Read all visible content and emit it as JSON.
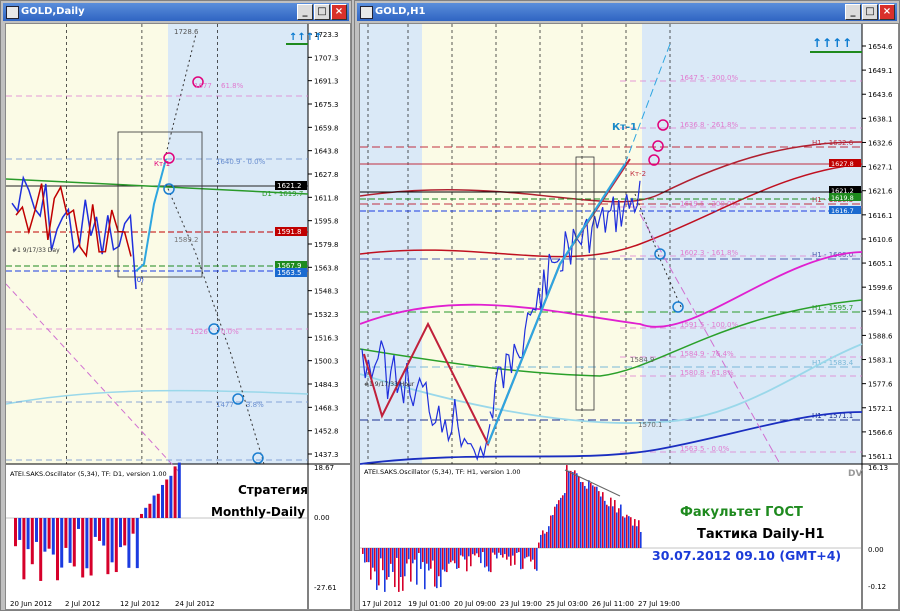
{
  "left_window": {
    "title": "GOLD,Daily",
    "buttons": {
      "minimize": "_",
      "maximize": "□",
      "close": "×"
    }
  },
  "right_window": {
    "title": "GOLD,H1",
    "buttons": {
      "minimize": "_",
      "maximize": "□",
      "close": "×"
    }
  },
  "colors": {
    "bg_yellow": "#fbfbe6",
    "bg_blue": "#dae9f7",
    "bars_blue": "#1f2fdc",
    "bars_red": "#c00000",
    "impulse": "#2ea6e0",
    "osc_red": "#d6002a",
    "osc_blue": "#1b3be0",
    "fib_pink": "#e07bd0",
    "fib_blue": "#6a8fd0",
    "circle_mag": "#e0007a",
    "circle_blue": "#1a7ed0",
    "caption_green": "#1e8a1e",
    "caption_blue": "#1b3bd8"
  },
  "chart_data": [
    {
      "type": "line",
      "title": "GOLD,Daily",
      "y_ticks": [
        "1723.3",
        "1707.3",
        "1691.3",
        "1675.3",
        "1659.8",
        "1643.8",
        "1627.8",
        "1611.8",
        "1595.8",
        "1579.8",
        "1563.8",
        "1548.3",
        "1532.3",
        "1516.3",
        "1500.3",
        "1484.3",
        "1468.3",
        "1452.8",
        "1437.3"
      ],
      "x_ticks": [
        "20 Jun 2012",
        "2 Jul 2012",
        "12 Jul 2012",
        "24 Jul 2012"
      ],
      "price_badges": {
        "current": "1621.2",
        "red": "1591.8",
        "green": "1567.9",
        "blue": "1563.5"
      },
      "annotations": {
        "top_price": "1728.6",
        "fib_61": "61.8%",
        "fib_61_price": "1677",
        "fib_1640": "1640.9 - 0.0%",
        "d1_level": "D1 - 1619.7",
        "mid_level": "1589.2",
        "low_fib": "1526",
        "low_fib_pct": "0.0%",
        "bottom_fib": "1477",
        "bottom_fib_pct": "3.8%",
        "kt1": "Кт-1",
        "zero_point": "(0)",
        "series_label": "#1 9/17/33 Day",
        "arrows": "↑↑↑↑"
      },
      "oscillator": {
        "label": "ATEI.SAKS.Oscillator (5,34), TF: D1, version 1.00",
        "y_ticks": [
          "18.67",
          "0.00",
          "-27.61"
        ]
      },
      "caption_lines": [
        "Стратегия",
        "Monthly-Daily"
      ],
      "x_range": [
        0,
        100
      ],
      "y_range": [
        1437.3,
        1723.3
      ]
    },
    {
      "type": "line",
      "title": "GOLD,H1",
      "y_ticks": [
        "1654.6",
        "1649.1",
        "1643.6",
        "1638.1",
        "1632.6",
        "1627.1",
        "1621.6",
        "1616.1",
        "1610.6",
        "1605.1",
        "1599.6",
        "1594.1",
        "1588.6",
        "1583.1",
        "1577.6",
        "1572.1",
        "1566.6",
        "1561.1"
      ],
      "x_ticks": [
        "17 Jul 2012",
        "19 Jul 01:00",
        "20 Jul 09:00",
        "23 Jul 19:00",
        "25 Jul 03:00",
        "26 Jul 11:00",
        "27 Jul 19:00"
      ],
      "price_badges": {
        "red": "1627.8",
        "current": "1621.2",
        "green": "1619.8",
        "blue": "1616.7"
      },
      "levels": [
        {
          "text": "H1 - 1632.6"
        },
        {
          "text": "H1 - 1620.3"
        },
        {
          "text": "H1 - 1608.0"
        },
        {
          "text": "H1 - 1595.7"
        },
        {
          "text": "H1 - 1583.4"
        },
        {
          "text": "H1 - 1571.1"
        }
      ],
      "fibs": [
        "1647.5 - 300.0%",
        "1636.8 - 261.8%",
        "1619.5 - 200.0%",
        "1602.3 - 161.8%",
        "1591.5 - 100.0%",
        "1584.9 - 76.4%",
        "1580.8 - 61.8%",
        "1563.5 - 0.0%"
      ],
      "annotations": {
        "kt1": "Кт-1",
        "kt2": "Кт-2",
        "mid_label": "1584.9",
        "low_label": "1570.1",
        "series_label": "#1 9/17/33 Hour",
        "arrows": "↑↑↑↑",
        "dv": "DV"
      },
      "oscillator": {
        "label": "ATEI.SAKS.Oscillator (5,34), TF: H1, version 1.00",
        "y_ticks": [
          "16.13",
          "0.00",
          "-0.12"
        ]
      },
      "caption_lines": [
        "Факультет ГОСТ",
        "Тактика Daily-H1",
        "30.07.2012  09.10 (GMT+4)"
      ],
      "x_range": [
        0,
        100
      ],
      "y_range": [
        1561.1,
        1654.6
      ]
    }
  ]
}
